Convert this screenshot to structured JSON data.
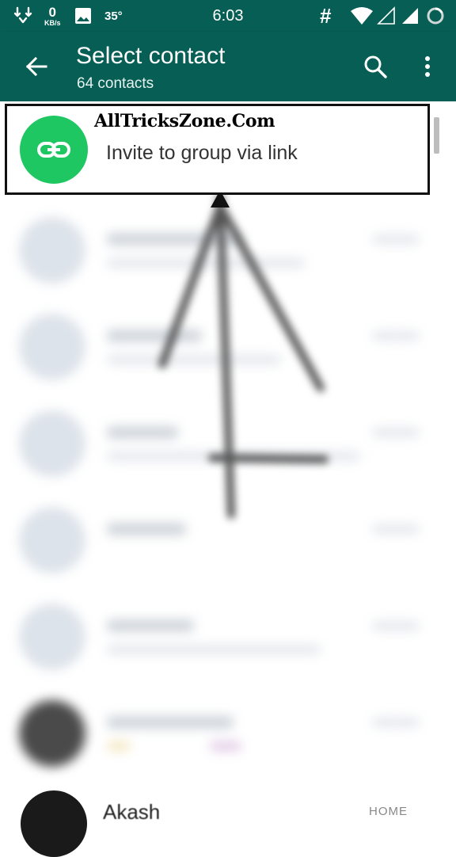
{
  "status_bar": {
    "speed_value": "0",
    "speed_unit": "KB/s",
    "temperature": "35°",
    "time": "6:03",
    "hash_symbol": "#",
    "icons": [
      "download-icon",
      "image-icon",
      "wifi-icon",
      "signal-empty-icon",
      "signal-icon",
      "battery-charging-icon"
    ]
  },
  "app_bar": {
    "title": "Select contact",
    "subtitle": "64 contacts",
    "icons": [
      "back-arrow-icon",
      "search-icon",
      "more-vert-icon"
    ]
  },
  "invite_row": {
    "label": "Invite to group via link",
    "icon": "link-icon",
    "icon_color": "#1ec761",
    "highlight_border": "#111111"
  },
  "watermark": "AllTricksZone.Com",
  "partial_contact": {
    "name": "Akash",
    "tag": "HOME"
  },
  "colors": {
    "app_bar": "#075e54",
    "background": "#ffffff"
  }
}
